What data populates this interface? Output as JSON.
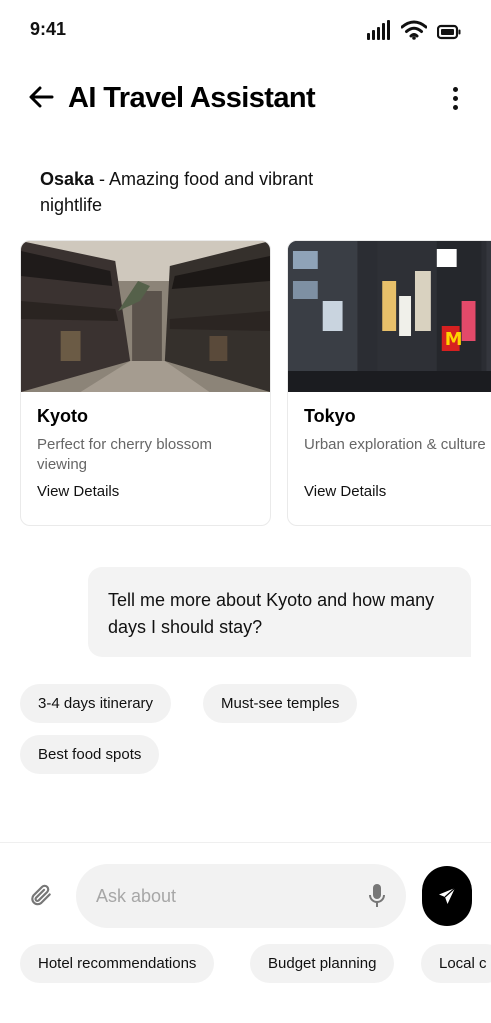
{
  "status_bar": {
    "time": "9:41"
  },
  "header": {
    "title": "AI Travel Assistant"
  },
  "intro": {
    "city": "Osaka",
    "text": " - Amazing food and vibrant nightlife"
  },
  "cards": [
    {
      "title": "Kyoto",
      "description": "Perfect for cherry blossom viewing",
      "link": "View Details"
    },
    {
      "title": "Tokyo",
      "description": "Urban exploration & culture",
      "link": "View Details"
    }
  ],
  "user_message": {
    "text": "Tell me more about Kyoto and how many days I should stay?"
  },
  "suggestions": [
    "3-4 days itinerary",
    "Must-see temples",
    "Best food spots"
  ],
  "composer": {
    "placeholder": "Ask about"
  },
  "quick_chips": [
    "Hotel recommendations",
    "Budget planning",
    "Local c"
  ],
  "colors": {
    "accent": "#000000",
    "chip_bg": "#f2f2f2",
    "bubble_bg": "#f3f3f3"
  }
}
